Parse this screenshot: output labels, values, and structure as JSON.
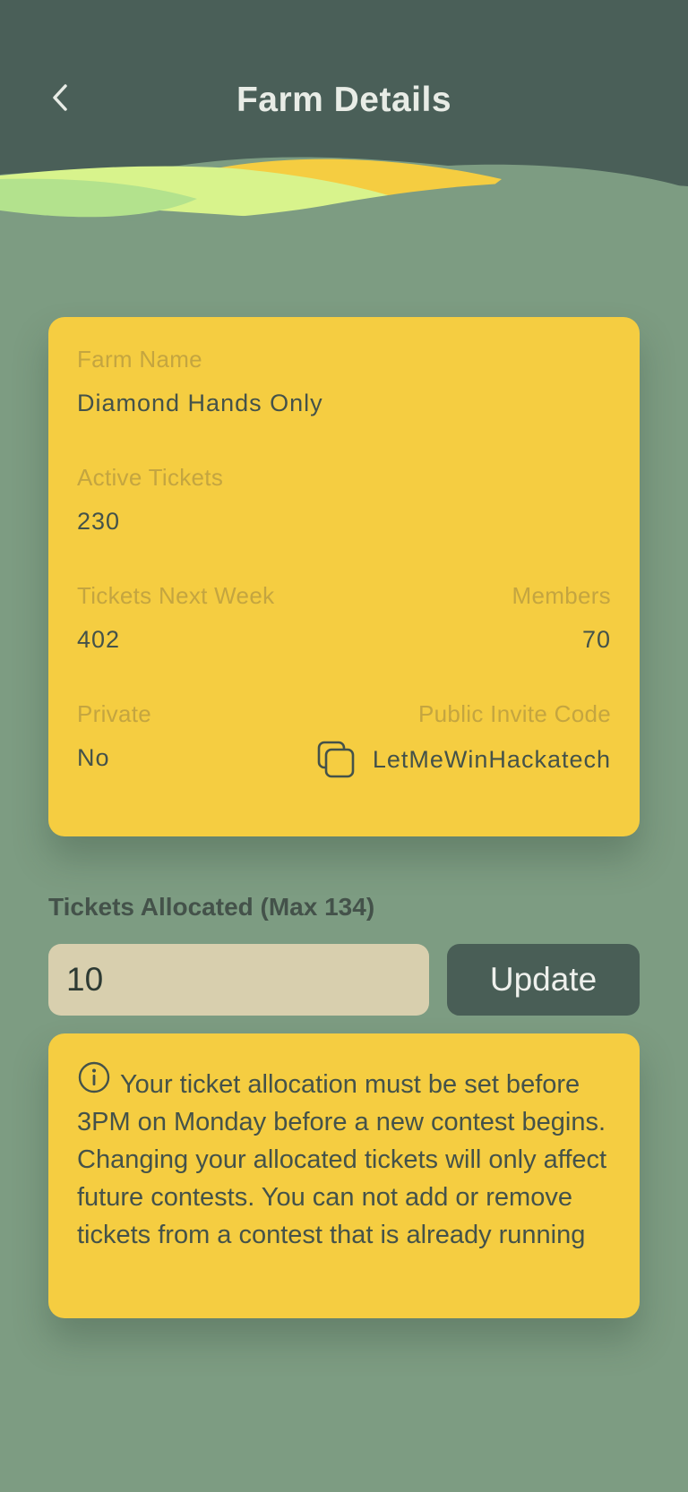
{
  "header": {
    "title": "Farm Details",
    "back_icon": "chevron-left-icon"
  },
  "farm": {
    "name_label": "Farm Name",
    "name_value": "Diamond Hands Only",
    "active_tickets_label": "Active Tickets",
    "active_tickets_value": "230",
    "tickets_next_week_label": "Tickets Next Week",
    "tickets_next_week_value": "402",
    "members_label": "Members",
    "members_value": "70",
    "private_label": "Private",
    "private_value": "No",
    "invite_code_label": "Public Invite Code",
    "invite_code_value": "LetMeWinHackatech",
    "copy_icon": "copy-icon"
  },
  "allocation": {
    "label": "Tickets Allocated (Max 134)",
    "input_value": "10",
    "update_label": "Update"
  },
  "info": {
    "icon": "info-icon",
    "text": "Your ticket allocation must be set before 3PM on Monday before a new contest begins. Changing your allocated tickets will only affect future contests. You can not add or remove tickets from a contest that is already running"
  },
  "colors": {
    "header_bg": "#4a5f58",
    "page_bg": "#7d9c82",
    "card_bg": "#f5cd41",
    "button_bg": "#495e56",
    "input_bg": "#d8cfae",
    "label_color": "#c4a540",
    "text_color": "#44524a"
  }
}
